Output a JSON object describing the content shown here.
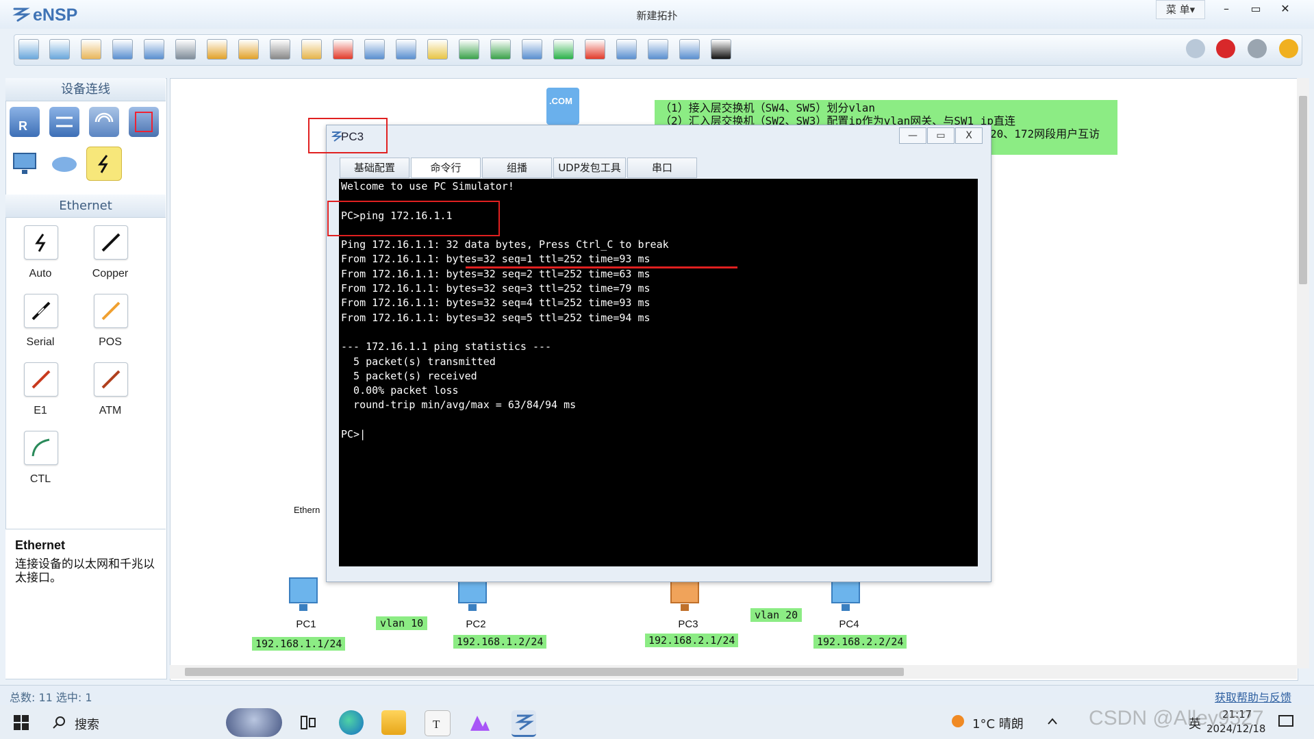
{
  "app": {
    "name": "eNSP",
    "window_title": "新建拓扑",
    "menu_label": "菜 单▾",
    "window_controls": {
      "minimize": "–",
      "maximize": "▭",
      "close": "✕"
    }
  },
  "toolbar": {
    "tools": [
      "new-topology",
      "new-test",
      "open",
      "save",
      "save-as",
      "print",
      "undo",
      "redo",
      "select",
      "pan",
      "delete",
      "delete-all-links",
      "text",
      "rectangle",
      "zoom-in",
      "zoom-out",
      "fit",
      "start-device",
      "stop-device",
      "capture",
      "topology-view",
      "grid",
      "terminal"
    ],
    "right_tools": [
      "forum",
      "huawei",
      "settings",
      "help"
    ]
  },
  "left_panel": {
    "devices_header": "设备连线",
    "devices": [
      "router",
      "switch",
      "wireless",
      "firewall",
      "pc",
      "cloud",
      "link"
    ],
    "cables_header": "Ethernet",
    "cables": [
      {
        "label": "Auto",
        "color": "#111111"
      },
      {
        "label": "Copper",
        "color": "#111111"
      },
      {
        "label": "Serial",
        "color": "#111111"
      },
      {
        "label": "POS",
        "color": "#f0a030"
      },
      {
        "label": "E1",
        "color": "#c83a1e"
      },
      {
        "label": "ATM",
        "color": "#b0401e"
      },
      {
        "label": "CTL",
        "color": "#2a8a5a"
      }
    ],
    "description": {
      "title": "Ethernet",
      "text": "连接设备的以太网和千兆以太接口。"
    }
  },
  "canvas": {
    "note_lines": [
      "（1）接入层交换机（SW4、SW5）划分vlan",
      "（2）汇入层交换机（SW2、SW3）配置ip作为vlan网关、与SW1 ip直连",
      "20、172网段用户互访"
    ],
    "ethern_label": "Ethern",
    "pcs": [
      {
        "name": "PC1",
        "ip": "192.168.1.1/24"
      },
      {
        "name": "PC2",
        "ip": "192.168.1.2/24"
      },
      {
        "name": "PC3",
        "ip": "192.168.2.1/24"
      },
      {
        "name": "PC4",
        "ip": "192.168.2.2/24"
      }
    ],
    "vlan_tags": [
      "vlan 10",
      "vlan 20"
    ],
    "com_label": ".COM"
  },
  "dialog": {
    "title": "PC3",
    "controls": {
      "minimize": "—",
      "maximize": "▭",
      "close": "X"
    },
    "tabs": [
      "基础配置",
      "命令行",
      "组播",
      "UDP发包工具",
      "串口"
    ],
    "terminal_lines": [
      "Welcome to use PC Simulator!",
      "",
      "PC>ping 172.16.1.1",
      "",
      "Ping 172.16.1.1: 32 data bytes, Press Ctrl_C to break",
      "From 172.16.1.1: bytes=32 seq=1 ttl=252 time=93 ms",
      "From 172.16.1.1: bytes=32 seq=2 ttl=252 time=63 ms",
      "From 172.16.1.1: bytes=32 seq=3 ttl=252 time=79 ms",
      "From 172.16.1.1: bytes=32 seq=4 ttl=252 time=93 ms",
      "From 172.16.1.1: bytes=32 seq=5 ttl=252 time=94 ms",
      "",
      "--- 172.16.1.1 ping statistics ---",
      "  5 packet(s) transmitted",
      "  5 packet(s) received",
      "  0.00% packet loss",
      "  round-trip min/avg/max = 63/84/94 ms",
      "",
      "PC>|"
    ]
  },
  "status_bar": {
    "summary": "总数: 11  选中: 1",
    "help_link": "获取帮助与反馈"
  },
  "taskbar": {
    "search_label": "搜索",
    "weather": "1°C  晴朗",
    "ime": "英",
    "time": "21:17",
    "date": "2024/12/18",
    "watermark": "CSDN @Alley9527"
  }
}
